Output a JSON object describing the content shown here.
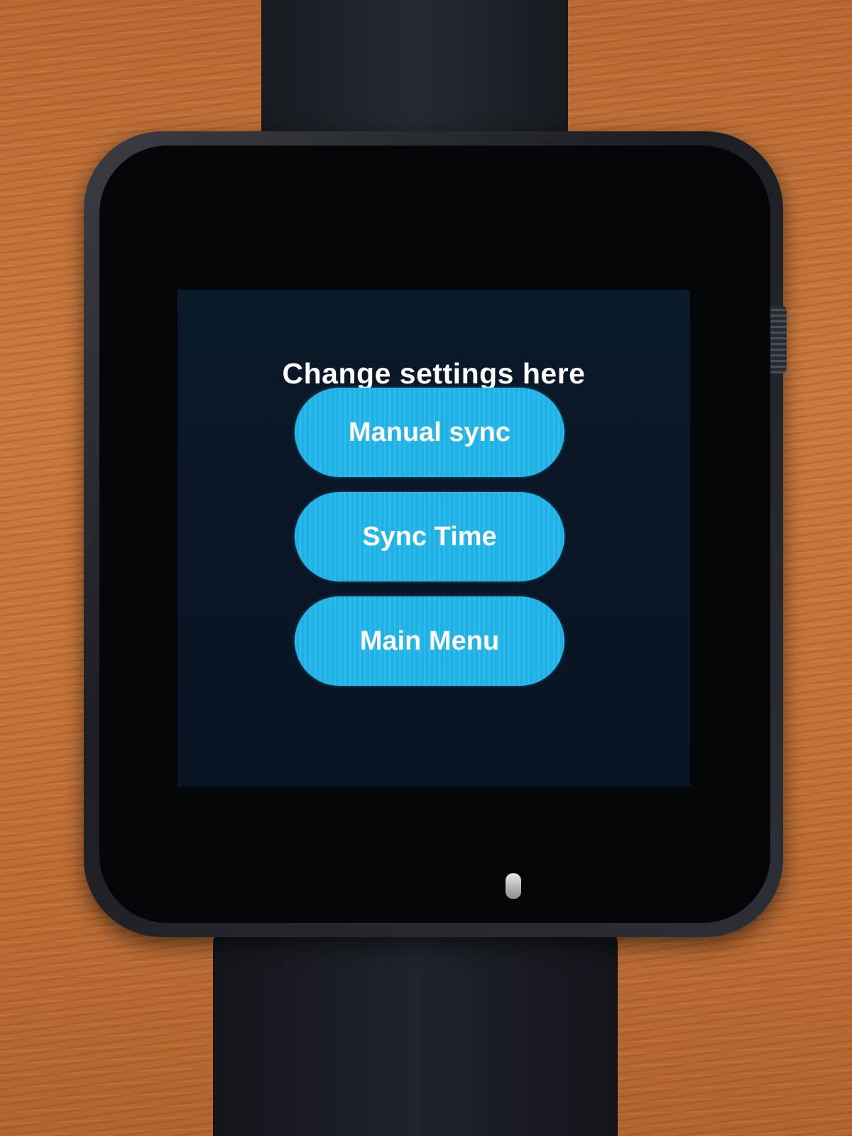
{
  "screen": {
    "title": "Change settings here",
    "buttons": [
      {
        "label": "Manual sync"
      },
      {
        "label": "Sync Time"
      },
      {
        "label": "Main Menu"
      }
    ]
  },
  "colors": {
    "button_fill": "#1fb2e6",
    "screen_background": "#0a1a28",
    "text": "#ffffff"
  }
}
